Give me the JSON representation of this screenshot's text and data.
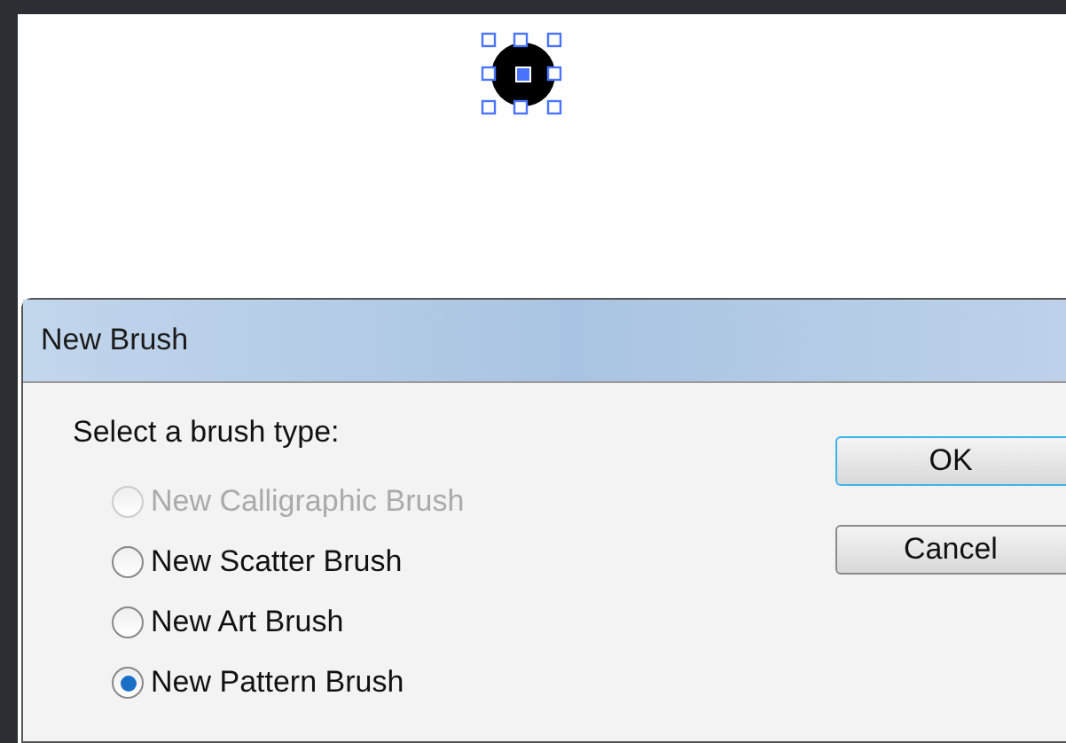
{
  "dialog": {
    "title": "New Brush",
    "prompt": "Select a brush type:",
    "options": [
      {
        "label": "New Calligraphic Brush",
        "selected": false,
        "disabled": true
      },
      {
        "label": "New Scatter Brush",
        "selected": false,
        "disabled": false
      },
      {
        "label": "New Art Brush",
        "selected": false,
        "disabled": false
      },
      {
        "label": "New Pattern Brush",
        "selected": true,
        "disabled": false
      }
    ],
    "buttons": [
      {
        "label": "OK",
        "default": true
      },
      {
        "label": "Cancel",
        "default": false
      }
    ]
  }
}
